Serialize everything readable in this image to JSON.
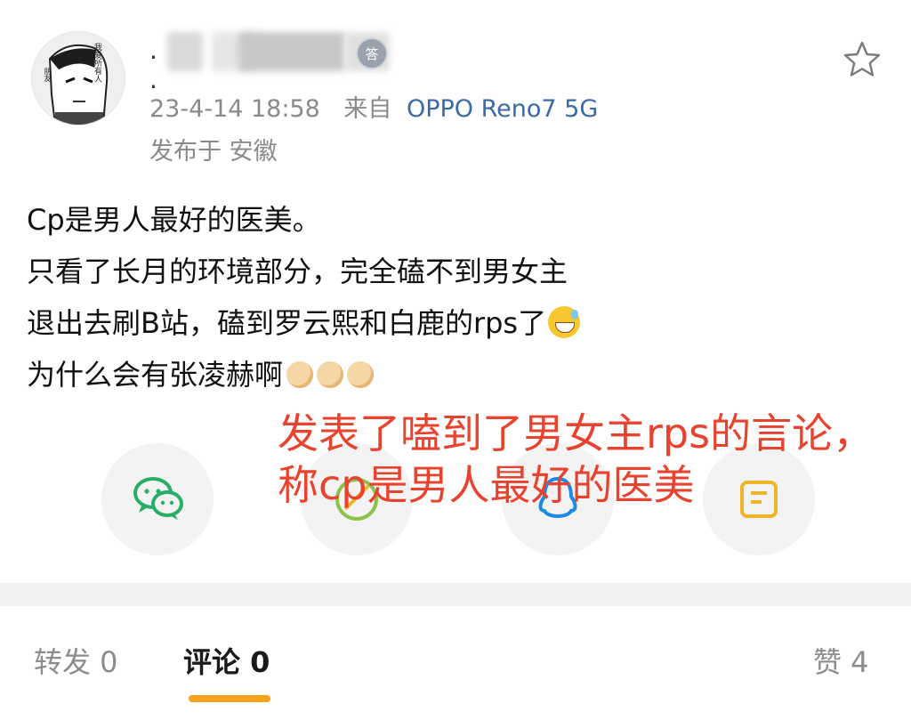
{
  "header": {
    "name_visible": ". .",
    "badge_text": "答",
    "timestamp": "23-4-14 18:58",
    "source_prefix": "来自",
    "device": "OPPO Reno7 5G",
    "location": "发布于 安徽",
    "avatar_text": "我爱所有人",
    "avatar_text2": "朋友"
  },
  "post": {
    "lines": [
      "Cp是男人最好的医美。",
      "只看了长月的环境部分，完全磕不到男女主",
      "退出去刷B站，磕到罗云熙和白鹿的rps了",
      "为什么会有张凌赫啊"
    ]
  },
  "annotation": {
    "text": "发表了嗑到了男女主rps的言论，称cp是男人最好的医美"
  },
  "share": {
    "icons": [
      "wechat-icon",
      "moments-icon",
      "qq-icon",
      "favorite-icon"
    ]
  },
  "tabs": {
    "repost": "转发 0",
    "comment": "评论 0",
    "like": "赞 4"
  },
  "colors": {
    "device_link": "#3b6aa8",
    "annotation": "#e8432f",
    "tab_underline": "#f7a21b"
  }
}
